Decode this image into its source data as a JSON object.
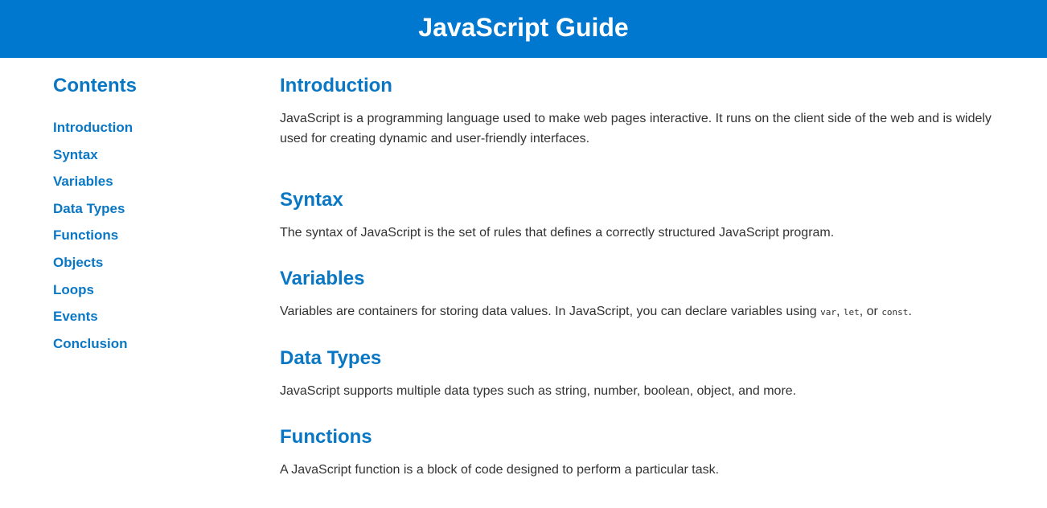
{
  "header": {
    "title": "JavaScript Guide",
    "background_color": "#0078cf"
  },
  "sidebar": {
    "heading": "Contents",
    "items": [
      {
        "label": "Introduction"
      },
      {
        "label": "Syntax"
      },
      {
        "label": "Variables"
      },
      {
        "label": "Data Types"
      },
      {
        "label": "Functions"
      },
      {
        "label": "Objects"
      },
      {
        "label": "Loops"
      },
      {
        "label": "Events"
      },
      {
        "label": "Conclusion"
      }
    ]
  },
  "main": {
    "sections": [
      {
        "title": "Introduction",
        "text": "JavaScript is a programming language used to make web pages interactive. It runs on the client side of the web and is widely used for creating dynamic and user-friendly interfaces."
      },
      {
        "title": "Syntax",
        "text": "The syntax of JavaScript is the set of rules that defines a correctly structured JavaScript program."
      },
      {
        "title": "Variables",
        "text_before": "Variables are containers for storing data values. In JavaScript, you can declare variables using",
        "code_var": "var",
        "sep1": ",",
        "code_let": "let",
        "sep2": ", or",
        "code_const": "const",
        "text_after": "."
      },
      {
        "title": "Data Types",
        "text": "JavaScript supports multiple data types such as string, number, boolean, object, and more."
      },
      {
        "title": "Functions",
        "text": "A JavaScript function is a block of code designed to perform a particular task."
      }
    ]
  },
  "colors": {
    "accent": "#0a77c4",
    "body_text": "#333333"
  }
}
